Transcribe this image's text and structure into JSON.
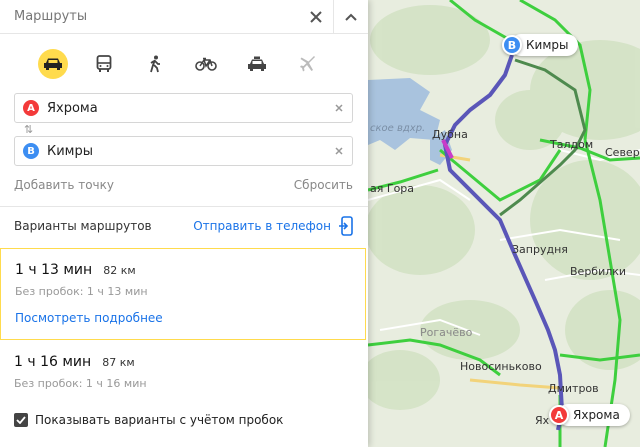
{
  "panel": {
    "title": "Маршруты",
    "close_icon": "close-icon",
    "collapse_icon": "chevron-up-icon",
    "modes": [
      {
        "name": "car",
        "icon": "car-icon",
        "active": true
      },
      {
        "name": "public-transport",
        "icon": "bus-icon",
        "active": false
      },
      {
        "name": "walk",
        "icon": "pedestrian-icon",
        "active": false
      },
      {
        "name": "bike",
        "icon": "bicycle-icon",
        "active": false
      },
      {
        "name": "taxi",
        "icon": "taxi-icon",
        "active": false
      },
      {
        "name": "plane",
        "icon": "plane-icon",
        "active": false
      }
    ],
    "from": {
      "badge": "A",
      "value": "Яхрома",
      "color": "#f33a3a"
    },
    "to": {
      "badge": "B",
      "value": "Кимры",
      "color": "#3d8ef2"
    },
    "add_point": "Добавить точку",
    "reset": "Сбросить",
    "variants_label": "Варианты маршрутов",
    "send_to_phone": "Отправить в телефон",
    "routes": [
      {
        "time": "1 ч 13 мин",
        "distance": "82 км",
        "no_traffic": "Без пробок: 1 ч 13 мин",
        "details": "Посмотреть подробнее",
        "selected": true
      },
      {
        "time": "1 ч 16 мин",
        "distance": "87 км",
        "no_traffic": "Без пробок: 1 ч 16 мин",
        "selected": false
      }
    ],
    "traffic_option": {
      "label": "Показывать варианты с учётом пробок",
      "checked": true
    }
  },
  "map": {
    "labels": {
      "dubna": "Дубна",
      "water": "ское вдхр.",
      "gora": "ая Гора",
      "talldom": "Талдом",
      "severny": "Северн",
      "zaprudnya": "Запрудня",
      "verbilki": "Вербилки",
      "rogachevo": "Рогачёво",
      "novosinkovo": "Новосиньково",
      "dmitrov": "Дмитров",
      "yakhroma_small": "Ях"
    },
    "pin_b": {
      "badge": "B",
      "label": "Кимры"
    },
    "pin_a": {
      "badge": "A",
      "label": "Яхрома"
    },
    "colors": {
      "route": "#5a56b8",
      "road_green": "#3ecf3e",
      "road_dark": "#4e8a4e",
      "water": "#a9c3de"
    }
  }
}
